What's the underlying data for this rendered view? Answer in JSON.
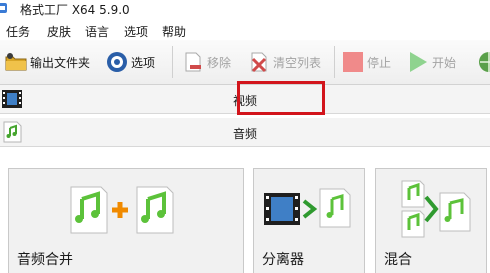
{
  "window": {
    "title": "格式工厂 X64 5.9.0"
  },
  "menu": {
    "items": [
      "任务",
      "皮肤",
      "语言",
      "选项",
      "帮助"
    ]
  },
  "toolbar": {
    "output_folder": "输出文件夹",
    "options": "选项",
    "remove": "移除",
    "clear_list": "清空列表",
    "stop": "停止",
    "start": "开始"
  },
  "categories": {
    "video": "视频",
    "audio": "音频"
  },
  "tiles": {
    "audio_merge": "音频合并",
    "splitter": "分离器",
    "mix": "混合"
  },
  "colors": {
    "highlight": "#d2141b",
    "note_green": "#5cc23a",
    "plus_orange": "#f08a00"
  }
}
